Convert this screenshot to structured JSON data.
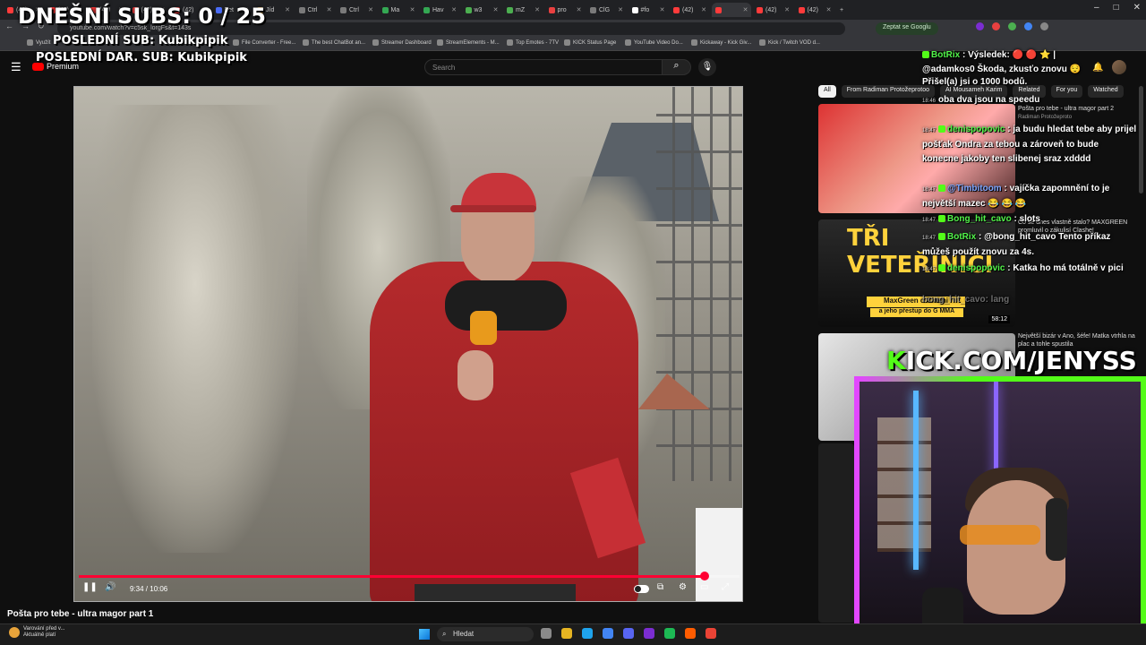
{
  "overlay": {
    "subs_today": "DNEŠNÍ SUBS: 0 / 25",
    "last_sub": "POSLEDNÍ SUB: Kubikpipik",
    "last_donation_sub": "POSLEDNÍ DAR. SUB: Kubikpipik"
  },
  "browser": {
    "tabs": [
      {
        "label": "(42)",
        "color": "#ff3b3b"
      },
      {
        "label": "(42)",
        "color": "#ff3b3b"
      },
      {
        "label": "(42)",
        "color": "#ff3b3b"
      },
      {
        "label": "(42)",
        "color": "#ff3b3b"
      },
      {
        "label": "(42)",
        "color": "#ff3b3b"
      },
      {
        "label": "Bet",
        "color": "#4a6cf7"
      },
      {
        "label": "Jíd",
        "color": "#e0a030"
      },
      {
        "label": "Ctrl",
        "color": "#7a7a7a"
      },
      {
        "label": "Ctrl",
        "color": "#7a7a7a"
      },
      {
        "label": "Ma",
        "color": "#34a853"
      },
      {
        "label": "Hav",
        "color": "#34a853"
      },
      {
        "label": "w3",
        "color": "#4caf50"
      },
      {
        "label": "mZ",
        "color": "#4caf50"
      },
      {
        "label": "pro",
        "color": "#e94040"
      },
      {
        "label": "ClG",
        "color": "#7a7a7a"
      },
      {
        "label": "#fo",
        "color": "#ffffff"
      },
      {
        "label": "(42)",
        "color": "#ff3b3b"
      },
      {
        "label": "",
        "color": "#ff3b3b"
      },
      {
        "label": "(42)",
        "color": "#ff3b3b"
      },
      {
        "label": "(42)",
        "color": "#ff3b3b"
      }
    ],
    "new_tab": "+",
    "url": "youtube.com/watch?v=c5sk_lorgFs&t=143s",
    "google_button": "Zeptat se Googlu",
    "bookmarks": [
      "Využít",
      "File Converter - Free...",
      "The best ChatBot an...",
      "Streamer Dashboard",
      "StreamElements - M...",
      "Top Emotes - 7TV",
      "KICK Status Page",
      "YouTube Video Do...",
      "Kickaway - Kick Giv...",
      "Kick / Twitch VOD d..."
    ]
  },
  "youtube": {
    "logo_label": "Premium",
    "search_placeholder": "Search",
    "video_title": "Pošta pro tebe - ultra magor part 1",
    "time_current": "9:34",
    "time_total": "10:06",
    "timecode": "9:34 / 10:06",
    "progress": 0.947,
    "chips": [
      "All",
      "From Radiman Protožeprotoo",
      "AI Mousameh Karim",
      "Related",
      "For you",
      "Watched"
    ],
    "recommended": [
      {
        "title": "Pošta pro tebe - ultra magor part 2",
        "channel": "Radiman Protožeproto"
      },
      {
        "title": "Co se dnes vlastně stalo? MAXGREEN promluvil o zákulisí Clashe!",
        "channel": "",
        "thumb_title": "TŘI VETEŘINÍCI",
        "thumb_caption1": "MaxGreen o Clashi",
        "thumb_caption2": "a jeho přestup do G MMA",
        "duration": "58:12"
      },
      {
        "title": "Největší bizár v Ano, šéfe! Matka vtrhla na plac a tohle spustila",
        "channel": ""
      }
    ]
  },
  "chat": [
    {
      "user": "BotRix",
      "text": ": Výsledek: 🔴 🔴 ⭐ |",
      "user_color": "green"
    },
    {
      "user": "",
      "text": "@adamkos0 Škoda, zkusťo znovu 😌",
      "user_color": "none"
    },
    {
      "user": "",
      "text": "Přišel(a) jsi o 1000 bodů.",
      "user_color": "none"
    },
    {
      "user": "",
      "time": "18:46",
      "text": "oba dva jsou na speedu",
      "user_color": "none"
    },
    {
      "user": "denispopovic",
      "time": "18:47",
      "text": ": ja budu hledat tebe aby prijel pošťak Ondra za tebou a zároveň to bude konecne jakoby ten slibenej sraz xdddd",
      "user_color": "green"
    },
    {
      "user": "@Timbitoom",
      "time": "18:47",
      "text": ": vajíčka zapomnění to je největší mazec 😂 😂 😂",
      "user_color": "blue"
    },
    {
      "user": "Bong_hit_cavo",
      "time": "18:47",
      "text": ": slots",
      "user_color": "green"
    },
    {
      "user": "BotRix",
      "time": "18:47",
      "text": ": @bong_hit_cavo Tento příkaz můžeš použít znovu za 4s.",
      "user_color": "green"
    },
    {
      "user": "denispopovic",
      "time": "18:47",
      "text": ": Katka ho má totálně v pici",
      "user_color": "green"
    },
    {
      "user": "",
      "text": "bong_hit_cavo: lang",
      "user_color": "faded"
    }
  ],
  "kick": {
    "brand_k": "K",
    "brand_rest": "ICK.COM/JENYSS"
  },
  "taskbar": {
    "weather_line1": "Varování před v...",
    "weather_line2": "Aktuálně platí",
    "search_label": "Hledat",
    "apps": [
      "#8a8a8a",
      "#e6b422",
      "#1fa3ec",
      "#4285f4",
      "#5865f2",
      "#7b2dd1",
      "#1db954",
      "#ff5c00",
      "#ea4335"
    ]
  },
  "colors": {
    "accent_red": "#ff0033",
    "kick_green": "#53fc18"
  }
}
